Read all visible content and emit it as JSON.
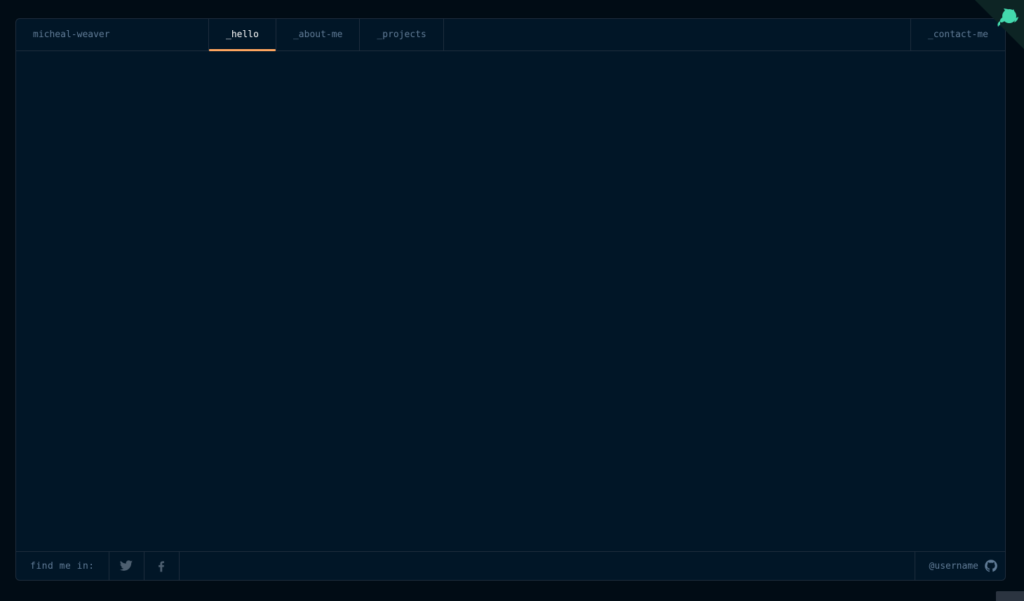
{
  "header": {
    "brand": "micheal-weaver",
    "tabs": [
      {
        "label": "_hello",
        "active": true
      },
      {
        "label": "_about-me",
        "active": false
      },
      {
        "label": "_projects",
        "active": false
      }
    ],
    "contact_label": "_contact-me"
  },
  "footer": {
    "find_label": "find me in:",
    "socials": [
      "twitter-icon",
      "facebook-icon"
    ],
    "github_username": "@username",
    "github_icon": "github-icon"
  },
  "colors": {
    "background": "#010c15",
    "panel": "#011627",
    "border": "#1e2d3d",
    "text": "#607b96",
    "active_text": "#ffffff",
    "accent": "#fea55f",
    "corner_accent": "#43d9ad"
  }
}
